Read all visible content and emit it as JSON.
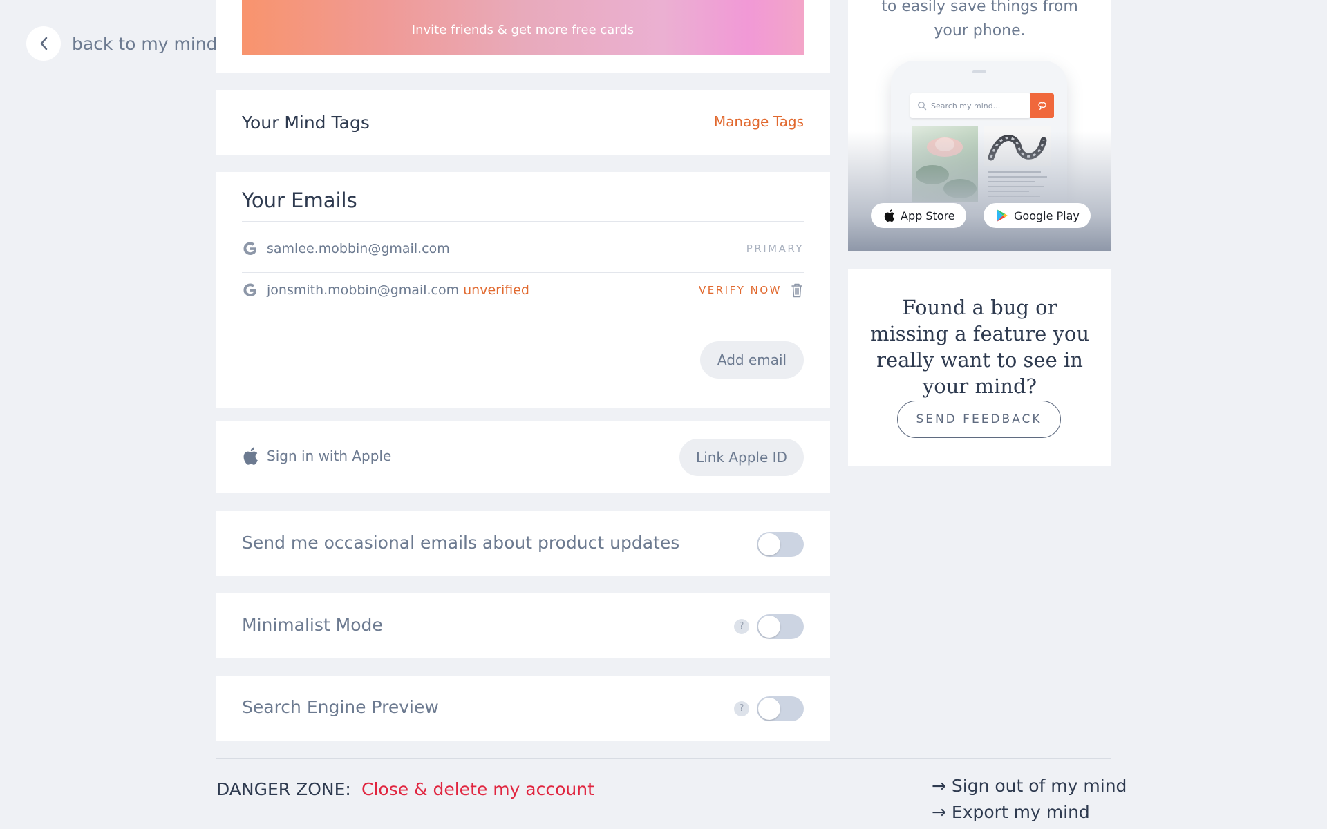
{
  "nav": {
    "back_label": "back to my mind"
  },
  "invite": {
    "link_text": "Invite friends & get more free cards"
  },
  "tags": {
    "title": "Your Mind Tags",
    "manage_label": "Manage Tags"
  },
  "emails": {
    "title": "Your Emails",
    "rows": [
      {
        "address": "samlee.mobbin@gmail.com",
        "status": "",
        "action": "PRIMARY"
      },
      {
        "address": "jonsmith.mobbin@gmail.com",
        "status": "unverified",
        "action": "VERIFY NOW"
      }
    ],
    "add_label": "Add email"
  },
  "apple": {
    "label": "Sign in with Apple",
    "button_label": "Link Apple ID"
  },
  "settings": [
    {
      "label": "Send me occasional emails about product updates",
      "enabled": false
    },
    {
      "label": "Minimalist Mode",
      "enabled": false,
      "help": "?"
    },
    {
      "label": "Search Engine Preview",
      "enabled": false,
      "help": "?"
    }
  ],
  "danger": {
    "label": "DANGER ZONE:",
    "delete_label": "Close & delete my account",
    "sign_out_label": "→ Sign out of my mind",
    "export_label": "→ Export my mind"
  },
  "promo": {
    "text_line1": "to easily save things from",
    "text_line2": "your phone.",
    "search_placeholder": "Search my mind...",
    "app_store_label": "App Store",
    "google_play_label": "Google Play"
  },
  "feedback": {
    "text": "Found a bug or missing a feature you really want to see in your mind?",
    "button_label": "SEND FEEDBACK"
  },
  "colors": {
    "accent": "#e1692f",
    "danger": "#e0253f",
    "background": "#eff1f5"
  }
}
